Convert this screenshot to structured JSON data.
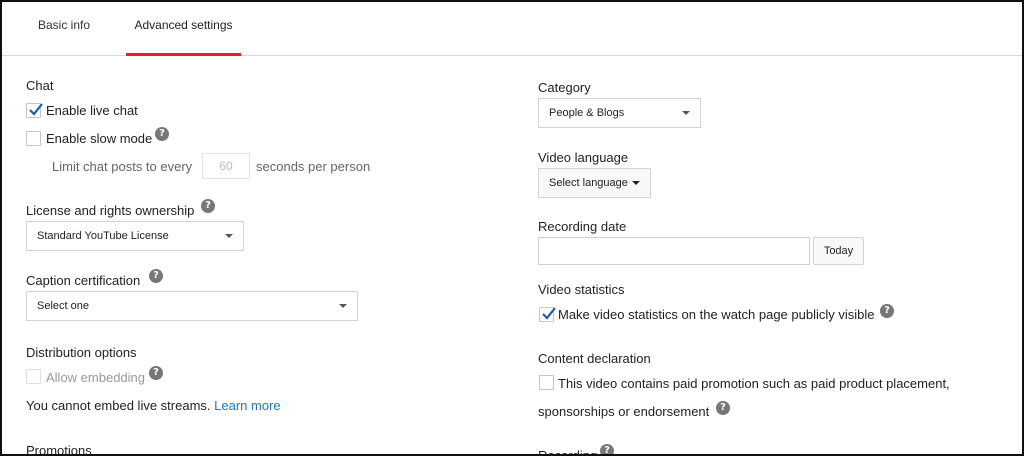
{
  "tabs": [
    {
      "label": "Basic info"
    },
    {
      "label": "Advanced settings"
    }
  ],
  "left": {
    "chat": {
      "title": "Chat",
      "enable_live_chat": {
        "label": "Enable live chat",
        "checked": true
      },
      "enable_slow_mode": {
        "label": "Enable slow mode",
        "checked": false
      },
      "limit_prefix": "Limit chat posts to every",
      "limit_value": "60",
      "limit_suffix": "seconds per person"
    },
    "license": {
      "title": "License and rights ownership",
      "selected": "Standard YouTube License"
    },
    "caption": {
      "title": "Caption certification",
      "selected": "Select one"
    },
    "distribution": {
      "title": "Distribution options",
      "allow_embedding": {
        "label": "Allow embedding",
        "checked": false,
        "disabled": true
      },
      "note": "You cannot embed live streams.",
      "learn_more": "Learn more"
    },
    "promotions": {
      "title": "Promotions"
    }
  },
  "right": {
    "category": {
      "title": "Category",
      "selected": "People & Blogs"
    },
    "video_language": {
      "title": "Video language",
      "selected": "Select language"
    },
    "recording_date": {
      "title": "Recording date",
      "value": "",
      "button": "Today"
    },
    "video_statistics": {
      "title": "Video statistics",
      "checkbox": {
        "label": "Make video statistics on the watch page publicly visible",
        "checked": true
      }
    },
    "content_declaration": {
      "title": "Content declaration",
      "line1": "This video contains paid promotion such as paid product placement,",
      "line2": "sponsorships or endorsement"
    },
    "recording": {
      "title": "Recording"
    }
  },
  "help_glyph": "?",
  "colors": {
    "accent_tab": "#e62117",
    "link": "#167ac6",
    "check": "#1a5ea8"
  }
}
